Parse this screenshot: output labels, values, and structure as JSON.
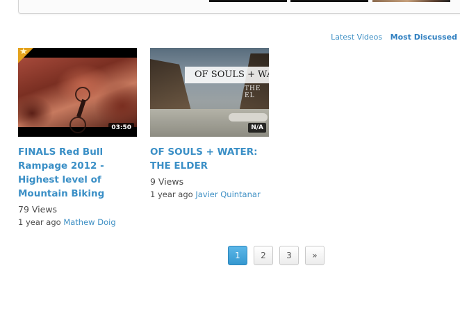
{
  "tabs": {
    "latest": "Latest Videos",
    "most_discussed": "Most Discussed"
  },
  "videos": [
    {
      "title": "FINALS Red Bull Rampage 2012 - Highest level of Mountain Biking",
      "duration": "03:50",
      "featured_icon": "star-icon",
      "views": "79 Views",
      "age": "1 year ago",
      "author": "Mathew Doig"
    },
    {
      "title": "OF SOULS + WATER: THE ELDER",
      "duration": "N/A",
      "thumbnail_text": "OF SOULS + WATER",
      "thumbnail_subtext": "THE EL",
      "views": "9 Views",
      "age": "1 year ago",
      "author": "Javier Quintanar"
    }
  ],
  "pagination": {
    "pages": [
      "1",
      "2",
      "3"
    ],
    "next": "»",
    "current": "1"
  },
  "colors": {
    "link": "#3a8fc6",
    "active_page": "#3598d0",
    "featured_badge": "#e4a21d"
  }
}
